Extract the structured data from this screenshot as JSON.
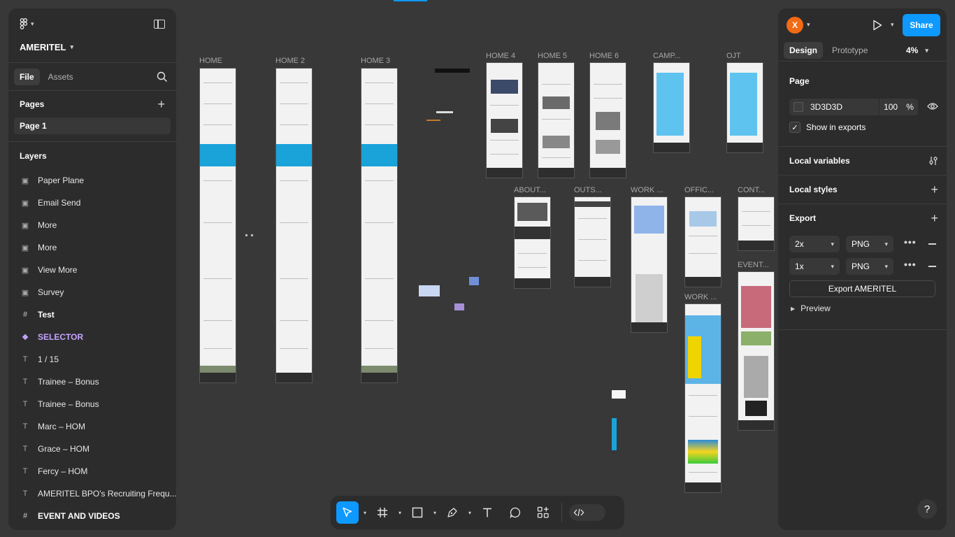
{
  "left": {
    "file_name": "AMERITEL",
    "tabs": [
      "File",
      "Assets"
    ],
    "pages_title": "Pages",
    "pages": [
      "Page 1"
    ],
    "layers_title": "Layers",
    "layers": [
      {
        "icon": "image-icon",
        "label": "Paper Plane"
      },
      {
        "icon": "image-icon",
        "label": "Email Send"
      },
      {
        "icon": "image-icon",
        "label": "More"
      },
      {
        "icon": "image-icon",
        "label": "More"
      },
      {
        "icon": "image-icon",
        "label": "View More"
      },
      {
        "icon": "image-icon",
        "label": "Survey"
      },
      {
        "icon": "frame-icon",
        "label": "Test"
      },
      {
        "icon": "component-icon",
        "label": "SELECTOR"
      },
      {
        "icon": "text-icon",
        "label": "1 / 15"
      },
      {
        "icon": "text-icon",
        "label": "Trainee – Bonus"
      },
      {
        "icon": "text-icon",
        "label": "Trainee – Bonus"
      },
      {
        "icon": "text-icon",
        "label": "Marc – HOM"
      },
      {
        "icon": "text-icon",
        "label": "Grace – HOM"
      },
      {
        "icon": "text-icon",
        "label": "Fercy – HOM"
      },
      {
        "icon": "text-icon",
        "label": "AMERITEL BPO's Recruiting Frequ..."
      },
      {
        "icon": "frame-icon",
        "label": "EVENT AND VIDEOS"
      }
    ]
  },
  "right": {
    "avatar_letter": "X",
    "share_label": "Share",
    "tabs": [
      "Design",
      "Prototype"
    ],
    "zoom": "4%",
    "page_section": {
      "title": "Page",
      "color_hex": "3D3D3D",
      "opacity": "100",
      "opacity_unit": "%",
      "show_in_exports": "Show in exports"
    },
    "local_variables": "Local variables",
    "local_styles": "Local styles",
    "export": {
      "title": "Export",
      "rows": [
        {
          "scale": "2x",
          "format": "PNG"
        },
        {
          "scale": "1x",
          "format": "PNG"
        }
      ],
      "button": "Export AMERITEL",
      "preview": "Preview"
    },
    "help": "?"
  },
  "canvas": {
    "background": "#383838",
    "frames": [
      {
        "label": "HOME"
      },
      {
        "label": "HOME 2"
      },
      {
        "label": "HOME 3"
      },
      {
        "label": "HOME 4"
      },
      {
        "label": "HOME 5"
      },
      {
        "label": "HOME 6"
      },
      {
        "label": "CAMP..."
      },
      {
        "label": "OJT"
      },
      {
        "label": "ABOUT..."
      },
      {
        "label": "OUTS..."
      },
      {
        "label": "WORK ..."
      },
      {
        "label": "OFFIC..."
      },
      {
        "label": "CONT..."
      },
      {
        "label": "EVENT..."
      },
      {
        "label": "WORK ..."
      }
    ]
  },
  "accent": "#0d99ff",
  "selector_color": "#c5a3ff"
}
